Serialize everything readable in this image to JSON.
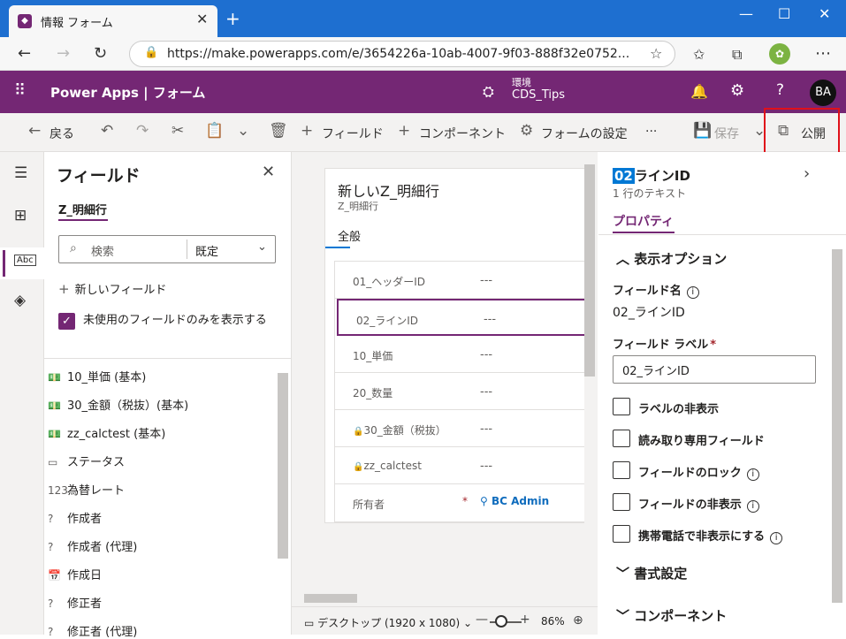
{
  "browser": {
    "tab_title": "情報 フォーム",
    "url": "https://make.powerapps.com/e/3654226a-10ab-4007-9f03-888f32e0752..."
  },
  "app": {
    "name": "Power Apps | フォーム",
    "env_label": "環境",
    "env_name": "CDS_Tips",
    "avatar": "BA"
  },
  "commands": {
    "back": "戻る",
    "field": "フィールド",
    "component": "コンポーネント",
    "form_settings": "フォームの設定",
    "more": "···",
    "save": "保存",
    "publish": "公開"
  },
  "fields_panel": {
    "title": "フィールド",
    "table": "Z_明細行",
    "search_placeholder": "検索",
    "filter": "既定",
    "new_field": "新しいフィールド",
    "unused_only": "未使用のフィールドのみを表示する",
    "items": [
      {
        "icon": "currency-icon",
        "glyph": "💵",
        "label": "10_単価 (基本)"
      },
      {
        "icon": "currency-icon",
        "glyph": "💵",
        "label": "30_金額（税抜）(基本)"
      },
      {
        "icon": "currency-icon",
        "glyph": "💵",
        "label": "zz_calctest (基本)"
      },
      {
        "icon": "option-set-icon",
        "glyph": "▭",
        "label": "ステータス"
      },
      {
        "icon": "number-icon",
        "glyph": "123",
        "label": "為替レート"
      },
      {
        "icon": "lookup-icon",
        "glyph": "?",
        "label": "作成者"
      },
      {
        "icon": "lookup-icon",
        "glyph": "?",
        "label": "作成者 (代理)"
      },
      {
        "icon": "date-icon",
        "glyph": "📅",
        "label": "作成日"
      },
      {
        "icon": "lookup-icon",
        "glyph": "?",
        "label": "修正者"
      },
      {
        "icon": "lookup-icon",
        "glyph": "?",
        "label": "修正者 (代理)"
      }
    ]
  },
  "form": {
    "title": "新しいZ_明細行",
    "subtitle": "Z_明細行",
    "tab": "全般",
    "rows": [
      {
        "label": "01_ヘッダーID",
        "value": "---",
        "locked": false
      },
      {
        "label": "02_ラインID",
        "value": "---",
        "locked": false
      },
      {
        "label": "10_単価",
        "value": "---",
        "locked": false
      },
      {
        "label": "20_数量",
        "value": "---",
        "locked": false
      },
      {
        "label": "30_金額（税抜）",
        "value": "---",
        "locked": true
      },
      {
        "label": "zz_calctest",
        "value": "---",
        "locked": true
      }
    ],
    "owner_label": "所有者",
    "owner_required": "*",
    "owner_value": "BC Admin"
  },
  "footer": {
    "view": "デスクトップ (1920 x 1080)",
    "zoom": "86%"
  },
  "properties": {
    "name_hl": "02",
    "name_rest": "ラインID",
    "type": "1 行のテキスト",
    "tab": "プロパティ",
    "section_display": "表示オプション",
    "field_name_label": "フィールド名",
    "field_name_value": "02_ラインID",
    "field_label_label": "フィールド ラベル",
    "field_label_required": "*",
    "field_label_value": "02_ラインID",
    "checkboxes": [
      {
        "label": "ラベルの非表示",
        "info": false
      },
      {
        "label": "読み取り専用フィールド",
        "info": false
      },
      {
        "label": "フィールドのロック",
        "info": true
      },
      {
        "label": "フィールドの非表示",
        "info": true
      },
      {
        "label": "携帯電話で非表示にする",
        "info": true
      }
    ],
    "section_format": "書式設定",
    "section_component": "コンポーネント"
  },
  "colors": {
    "brand": "#742774",
    "highlight": "#e0101a",
    "titlebar": "#1e6fd0"
  }
}
